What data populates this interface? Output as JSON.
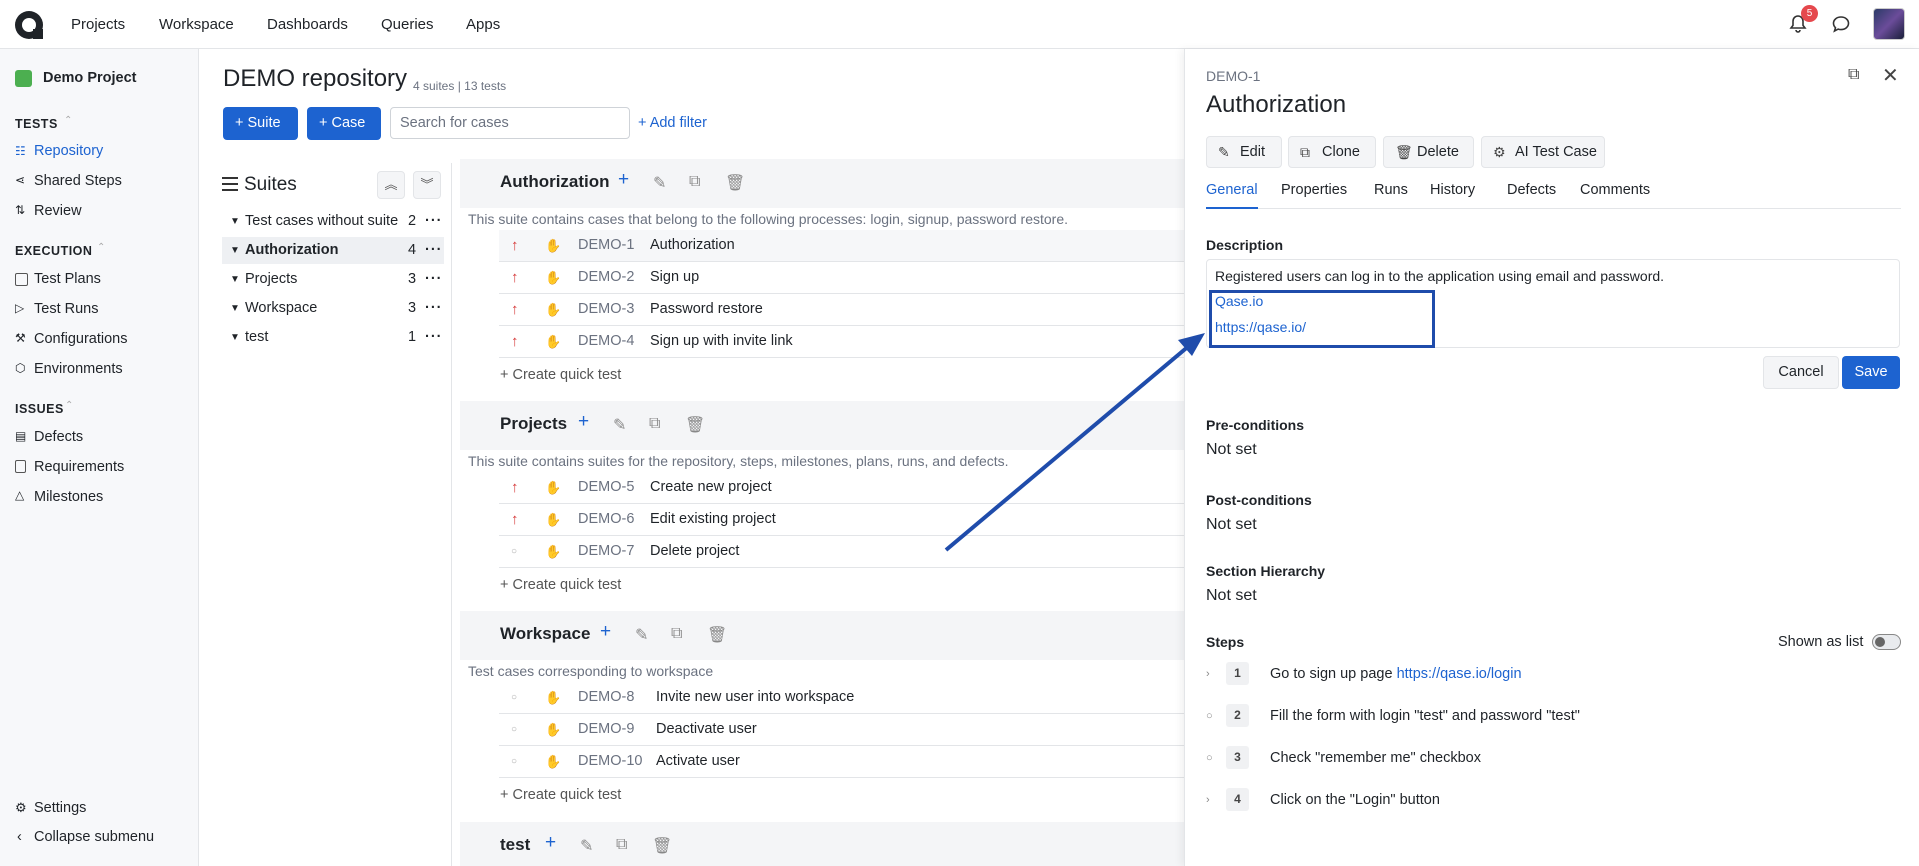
{
  "topnav": {
    "items": [
      "Projects",
      "Workspace",
      "Dashboards",
      "Queries",
      "Apps"
    ],
    "notifications_count": "5"
  },
  "sidebar": {
    "project": "Demo Project",
    "tests_head": "TESTS",
    "tests_items": [
      "Repository",
      "Shared Steps",
      "Review"
    ],
    "execution_head": "EXECUTION",
    "execution_items": [
      "Test Plans",
      "Test Runs",
      "Configurations",
      "Environments"
    ],
    "issues_head": "ISSUES",
    "issues_items": [
      "Defects",
      "Requirements",
      "Milestones"
    ],
    "settings": "Settings",
    "collapse": "Collapse submenu"
  },
  "main": {
    "title": "DEMO repository",
    "subtitle": "4 suites | 13 tests",
    "suite_btn": "+ Suite",
    "case_btn": "+ Case",
    "search_placeholder": "Search for cases",
    "add_filter": "+ Add filter"
  },
  "tree": {
    "title": "Suites",
    "items": [
      {
        "label": "Test cases without suite",
        "count": "2"
      },
      {
        "label": "Authorization",
        "count": "4"
      },
      {
        "label": "Projects",
        "count": "3"
      },
      {
        "label": "Workspace",
        "count": "3"
      },
      {
        "label": "test",
        "count": "1"
      }
    ]
  },
  "suites": [
    {
      "name": "Authorization",
      "desc": "This suite contains cases that belong to the following processes: login, signup, password restore.",
      "cases": [
        {
          "id": "DEMO-1",
          "title": "Authorization",
          "priority": "high"
        },
        {
          "id": "DEMO-2",
          "title": "Sign up",
          "priority": "high"
        },
        {
          "id": "DEMO-3",
          "title": "Password restore",
          "priority": "high"
        },
        {
          "id": "DEMO-4",
          "title": "Sign up with invite link",
          "priority": "high"
        }
      ]
    },
    {
      "name": "Projects",
      "desc": "This suite contains suites for the repository, steps, milestones, plans, runs, and defects.",
      "cases": [
        {
          "id": "DEMO-5",
          "title": "Create new project",
          "priority": "high"
        },
        {
          "id": "DEMO-6",
          "title": "Edit existing project",
          "priority": "high"
        },
        {
          "id": "DEMO-7",
          "title": "Delete project",
          "priority": "none"
        }
      ]
    },
    {
      "name": "Workspace",
      "desc": "Test cases corresponding to workspace",
      "cases": [
        {
          "id": "DEMO-8",
          "title": "Invite new user into workspace",
          "priority": "none"
        },
        {
          "id": "DEMO-9",
          "title": "Deactivate user",
          "priority": "none"
        },
        {
          "id": "DEMO-10",
          "title": "Activate user",
          "priority": "none"
        }
      ]
    },
    {
      "name": "test"
    }
  ],
  "quick_test": "+ Create quick test",
  "panel": {
    "case_id": "DEMO-1",
    "title": "Authorization",
    "buttons": [
      "Edit",
      "Clone",
      "Delete",
      "AI Test Case"
    ],
    "tabs": [
      "General",
      "Properties",
      "Runs",
      "History",
      "Defects",
      "Comments"
    ],
    "description_label": "Description",
    "description_text": "Registered users can log in to the application using email and password.",
    "links": [
      "Qase.io",
      "https://qase.io/"
    ],
    "cancel": "Cancel",
    "save": "Save",
    "preconditions_label": "Pre-conditions",
    "postconditions_label": "Post-conditions",
    "hierarchy_label": "Section Hierarchy",
    "not_set": "Not set",
    "steps_label": "Steps",
    "shown_as_list": "Shown as list",
    "steps": [
      {
        "num": "1",
        "text": "Go to sign up page ",
        "link": "https://qase.io/login"
      },
      {
        "num": "2",
        "text": "Fill the form with login \"test\" and password \"test\""
      },
      {
        "num": "3",
        "text": "Check \"remember me\" checkbox"
      },
      {
        "num": "4",
        "text": "Click on the \"Login\" button"
      }
    ]
  },
  "colors": {
    "accent": "#1d63d0",
    "priority_high": "#d63b3b",
    "annotation": "#1f4cab"
  }
}
